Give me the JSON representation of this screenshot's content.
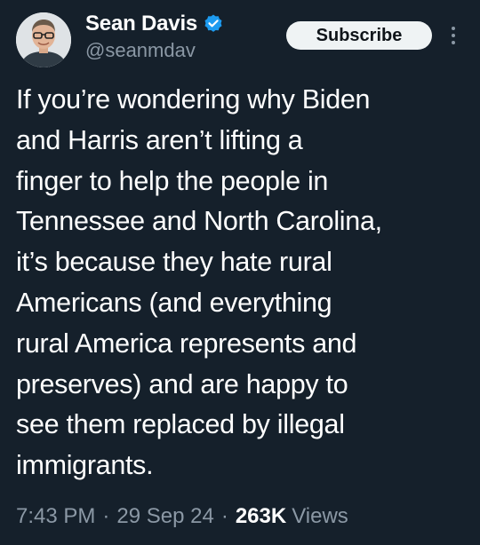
{
  "author": {
    "display_name": "Sean Davis",
    "handle": "@seanmdav",
    "verified_icon": "verified-badge-icon",
    "avatar_icon": "profile-photo"
  },
  "actions": {
    "subscribe_label": "Subscribe",
    "more_icon": "more-options-icon"
  },
  "tweet": {
    "text": "If you’re wondering why Biden\nand Harris aren’t lifting a\nfinger to help the people in\nTennessee and North Carolina,\nit’s because they hate rural\nAmericans (and everything\nrural America represents and\npreserves) and are happy to\nsee them replaced by illegal\nimmigrants."
  },
  "meta": {
    "time": "7:43 PM",
    "separator": "·",
    "date": "29 Sep 24",
    "views_count": "263K",
    "views_label": "Views"
  },
  "colors": {
    "background": "#15202b",
    "text": "#ffffff",
    "secondary": "#8b98a5",
    "verified": "#1d9bf0",
    "button_bg": "#eff3f4"
  }
}
